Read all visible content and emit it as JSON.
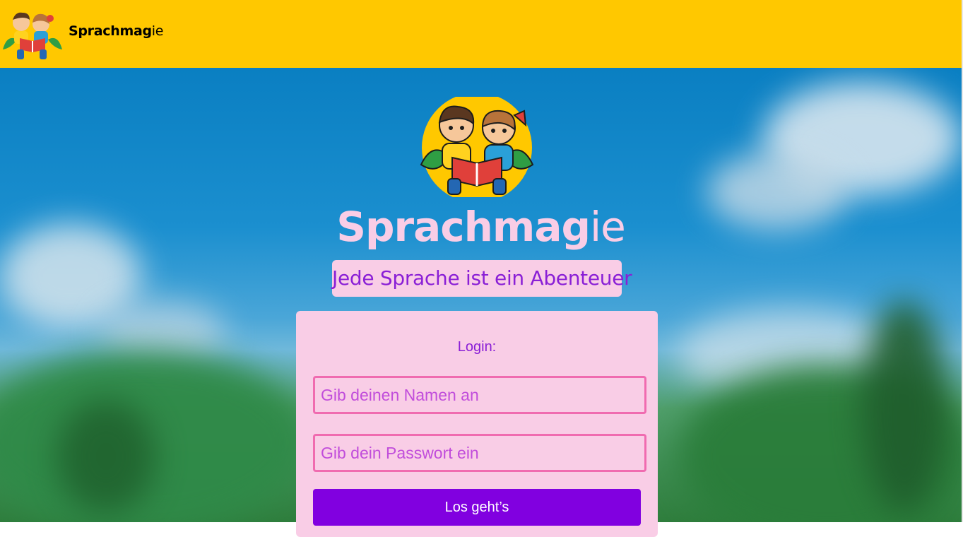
{
  "header": {
    "brand_bold": "Sprachmag",
    "brand_light": "ie",
    "logo_icon": "kids-reading-book-icon",
    "background_color": "#ffc800"
  },
  "hero": {
    "title_bold": "Sprachmag",
    "title_light": "ie",
    "tagline": "Jede Sprache ist ein Abenteuer",
    "logo_icon": "kids-reading-book-icon"
  },
  "login": {
    "title": "Login:",
    "name_placeholder": "Gib deinen Namen an",
    "password_placeholder": "Gib dein Passwort ein",
    "submit_label": "Los geht’s"
  },
  "colors": {
    "accent": "#8100e0",
    "pink": "#f9cde6",
    "input_border": "#f06bb0",
    "text_purple": "#8a1fd6"
  }
}
